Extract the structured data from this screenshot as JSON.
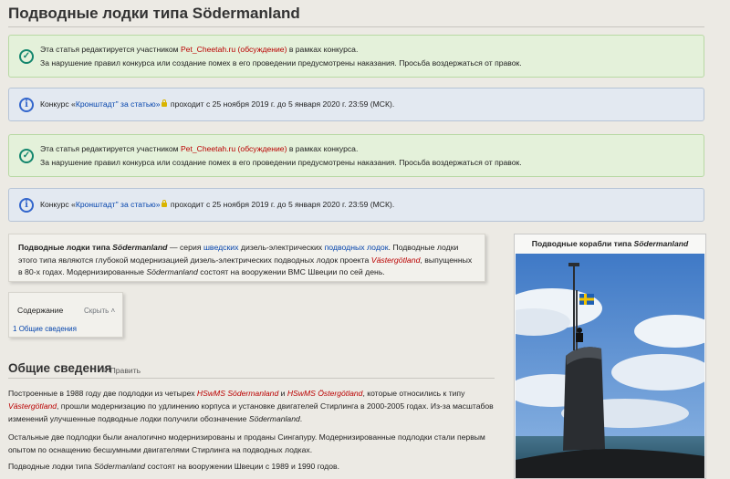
{
  "page": {
    "title": "Подводные лодки типа Södermanland"
  },
  "notices": [
    {
      "line1_a": "Эта статья редактируется участником ",
      "user": "Pet_Cheetah.ru",
      "talk": "(обсуждение)",
      "line1_b": " в рамках конкурса.",
      "line2": "За нарушение правил конкурса или создание помех в его проведении предусмотрены наказания. Просьба воздержаться от правок."
    },
    {
      "a": "Конкурс «",
      "link": "Кронштадт\" за статью»",
      "b": " проходит с 25 ноября 2019 г. до 5 января 2020 г. 23:59 (МСК)."
    }
  ],
  "lead": {
    "bold_a": "Подводные лодки типа ",
    "bold_i": "Södermanland",
    "t1": " — серия ",
    "l1": "шведских",
    "t2": " дизель-электрических ",
    "l2": "подводных лодок",
    "t3": ". Подводные лодки этого типа являются глубокой модернизацией дизель-электрических подводных лодок проекта ",
    "l3": "Västergötland",
    "t4": ", выпущенных в 80-х годах. Модернизированные ",
    "i1": "Södermanland",
    "t5": " состоят на вооружении ВМС Швеции по сей день."
  },
  "toc": {
    "heading": "Содержание",
    "hide": "Скрыть",
    "item_num": "1",
    "item_label": "Общие сведения"
  },
  "section": {
    "heading": "Общие сведения",
    "edit": "Править"
  },
  "paragraphs": {
    "p1": {
      "t1": "Построенные в 1988 году две подлодки из четырех ",
      "l1": "HSwMS Södermanland",
      "t2": " и ",
      "l2": "HSwMS Östergötland",
      "t3": ", которые относились к типу ",
      "l3": "Västergötland",
      "t4": ", прошли модернизацию по удлинению корпуса и установке двигателей Стирлинга в 2000-2005 годах. Из-за масштабов изменений улучшенные подводные лодки получили обозначение ",
      "i1": "Södermanland",
      "t5": "."
    },
    "p2": "Остальные две подлодки были аналогично модернизированы и проданы Сингапуру. Модернизированные подлодки стали первым опытом по оснащению бесшумными двигателями Стирлинга на подводных лодках.",
    "p3": {
      "t1": "Подводные лодки типа ",
      "i1": "Södermanland",
      "t2": " состоят на вооружении Швеции с 1989 и 1990 годов."
    }
  },
  "infobox": {
    "caption_a": "Подводные корабли типа ",
    "caption_i": "Södermanland"
  },
  "colors": {
    "link": "#0645ad",
    "redlink": "#ba0000",
    "notice_green": "#e4f1da",
    "notice_blue": "#e3e9f1"
  }
}
